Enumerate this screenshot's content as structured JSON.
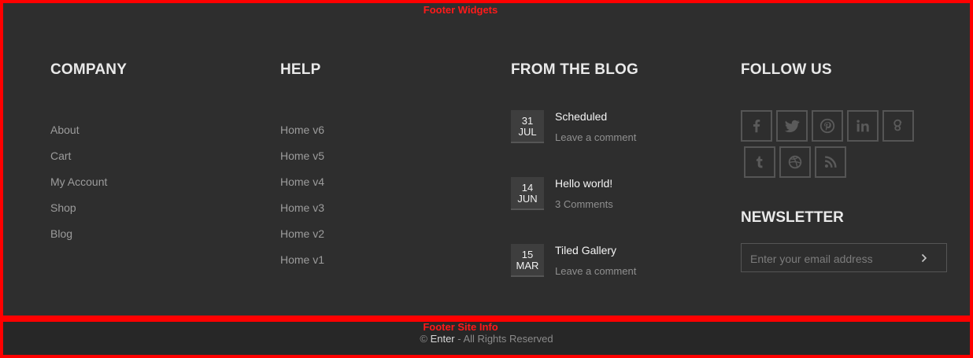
{
  "regions": {
    "widgets_label": "Footer Widgets",
    "siteinfo_label": "Footer Site Info"
  },
  "company": {
    "title": "COMPANY",
    "links": [
      "About",
      "Cart",
      "My Account",
      "Shop",
      "Blog"
    ]
  },
  "help": {
    "title": "HELP",
    "links": [
      "Home v6",
      "Home v5",
      "Home v4",
      "Home v3",
      "Home v2",
      "Home v1"
    ]
  },
  "blog": {
    "title": "FROM THE BLOG",
    "posts": [
      {
        "day": "31",
        "month": "JUL",
        "title": "Scheduled",
        "meta": "Leave a comment"
      },
      {
        "day": "14",
        "month": "JUN",
        "title": "Hello world!",
        "meta": "3 Comments"
      },
      {
        "day": "15",
        "month": "MAR",
        "title": "Tiled Gallery",
        "meta": "Leave a comment"
      }
    ]
  },
  "follow": {
    "title": "FOLLOW US",
    "icons": [
      "facebook-icon",
      "twitter-icon",
      "pinterest-icon",
      "linkedin-icon",
      "google-plus-icon",
      "tumblr-icon",
      "dribbble-icon",
      "rss-icon"
    ]
  },
  "newsletter": {
    "title": "NEWSLETTER",
    "placeholder": "Enter your email address"
  },
  "site_info": {
    "prefix": "©",
    "brand": "Enter",
    "suffix": "- All Rights Reserved"
  },
  "colors": {
    "background": "#2e2e2e",
    "bottom_bar": "#272727",
    "annotation": "#ff0000"
  }
}
